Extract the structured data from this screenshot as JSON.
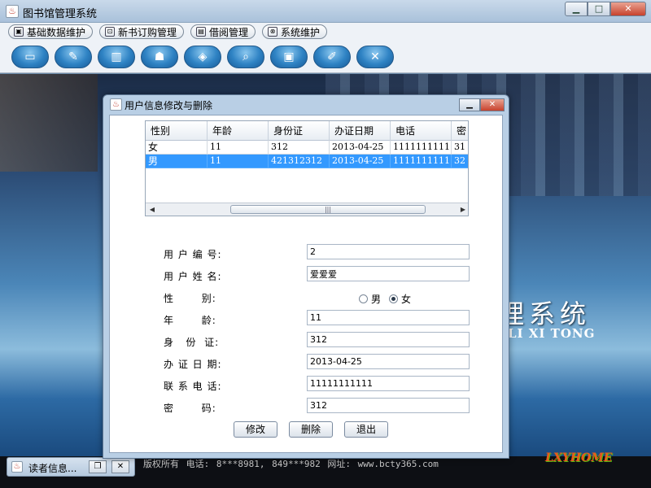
{
  "window": {
    "title": "图书馆管理系统"
  },
  "menu": [
    {
      "label": "基础数据维护",
      "icon": "box-icon"
    },
    {
      "label": "新书订购管理",
      "icon": "cart-icon"
    },
    {
      "label": "借阅管理",
      "icon": "lock-icon"
    },
    {
      "label": "系统维护",
      "icon": "link-icon"
    }
  ],
  "toolbar_icons": [
    "book-icon",
    "pen-icon",
    "folder-icon",
    "person-icon",
    "books-icon",
    "magnifier-icon",
    "monitor-icon",
    "edit-icon",
    "exit-icon"
  ],
  "desktop": {
    "brand_cn": "理系统",
    "brand_en": "LI XI TONG",
    "footer": "版权所有   电话: 8***8981, 849***982    网址: www.bcty365.com",
    "logo": "LXYHOME"
  },
  "minimized": {
    "label": "读者信息..."
  },
  "dialog": {
    "title": "用户信息修改与删除",
    "table": {
      "columns": [
        "性别",
        "年龄",
        "身份证",
        "办证日期",
        "电话",
        "密"
      ],
      "rows": [
        [
          "女",
          "11",
          "312",
          "2013-04-25",
          "11111111111",
          "31"
        ],
        [
          "男",
          "11",
          "421312312",
          "2013-04-25",
          "11111111111",
          "32"
        ]
      ],
      "selected_row": 1,
      "scroll_thumb": "|||"
    },
    "form": {
      "user_no_label": "用 户 编 号:",
      "user_no": "2",
      "user_name_label": "用 户 姓 名:",
      "user_name": "爱爱爱",
      "gender_label": "性       别:",
      "gender_male": "男",
      "gender_female": "女",
      "gender_selected": "女",
      "age_label": "年       龄:",
      "age": "11",
      "id_label": "身   份  证:",
      "id": "312",
      "date_label": "办 证 日 期:",
      "date": "2013-04-25",
      "phone_label": "联 系 电 话:",
      "phone": "11111111111",
      "password_label": "密       码:",
      "password": "312"
    },
    "buttons": {
      "modify": "修改",
      "delete": "删除",
      "exit": "退出"
    }
  }
}
